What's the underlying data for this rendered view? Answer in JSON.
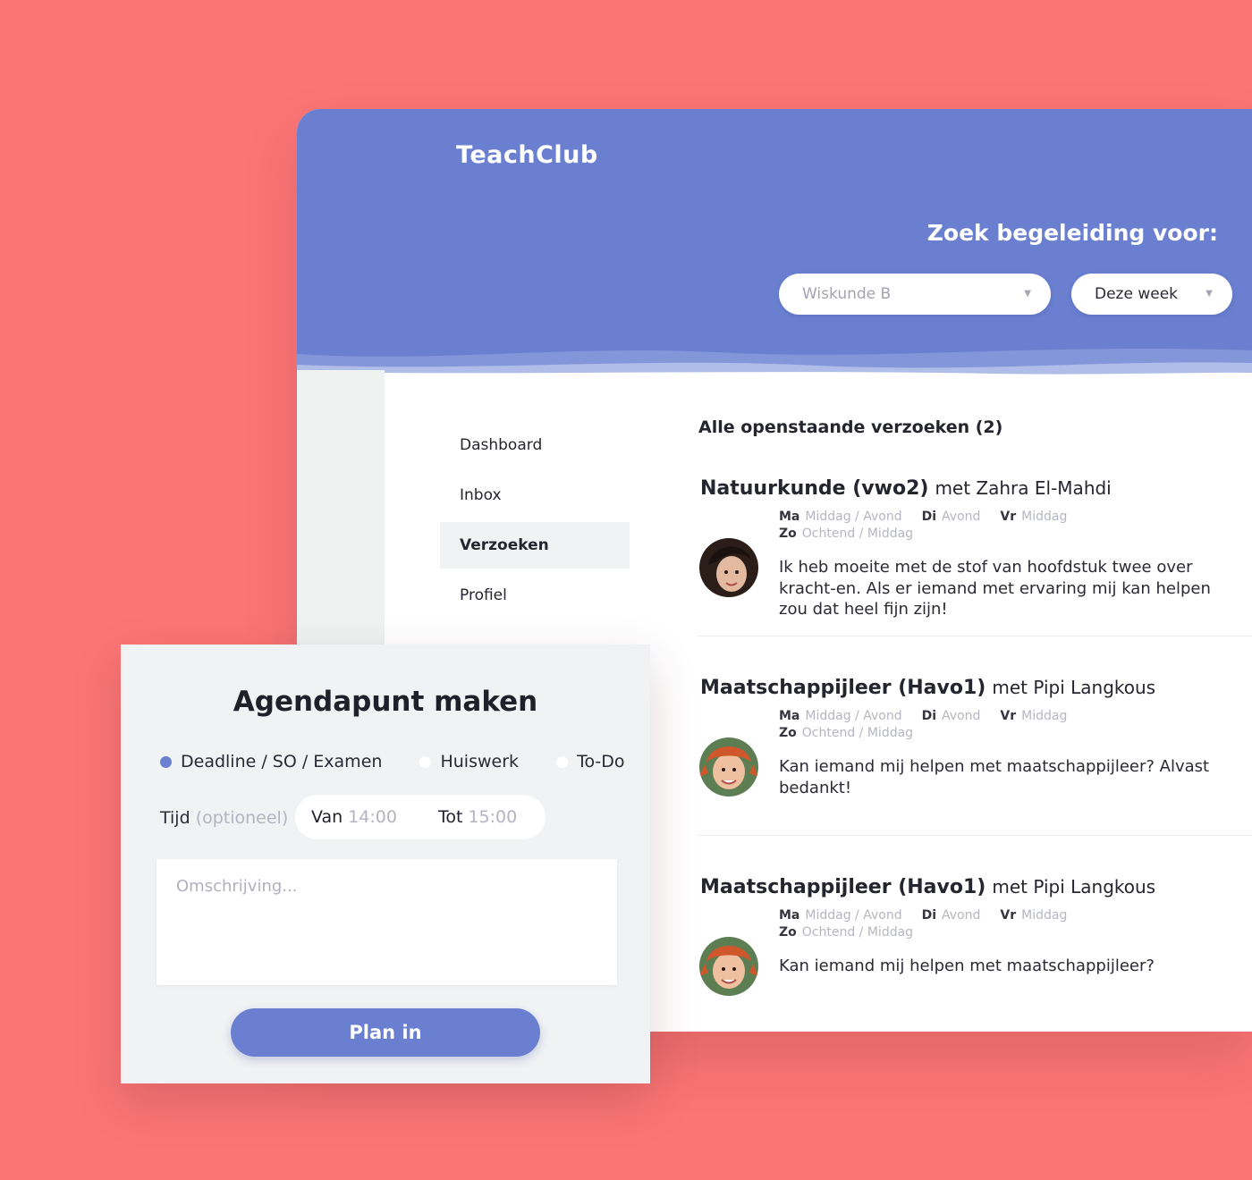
{
  "brand": {
    "name": "TeachClub"
  },
  "header": {
    "title": "Zoek begeleiding voor:",
    "subject_select": {
      "value": "Wiskunde B"
    },
    "period_select": {
      "value": "Deze week"
    }
  },
  "nav": {
    "items": [
      {
        "label": "Dashboard"
      },
      {
        "label": "Inbox"
      },
      {
        "label": "Verzoeken",
        "active": true
      },
      {
        "label": "Profiel"
      }
    ]
  },
  "requests": {
    "title": "Alle openstaande verzoeken (2)",
    "items": [
      {
        "subject": "Natuurkunde (vwo2)",
        "with": "met Zahra El-Mahdi",
        "times": [
          {
            "day": "Ma",
            "slot": "Middag / Avond"
          },
          {
            "day": "Di",
            "slot": "Avond"
          },
          {
            "day": "Vr",
            "slot": "Middag"
          },
          {
            "day": "Zo",
            "slot": "Ochtend / Middag"
          }
        ],
        "message": "Ik heb moeite met de stof van hoofdstuk twee over kracht-en. Als er iemand met ervaring mij kan helpen zou dat heel fijn zijn!"
      },
      {
        "subject": "Maatschappijleer (Havo1)",
        "with": "met Pipi Langkous",
        "times": [
          {
            "day": "Ma",
            "slot": "Middag / Avond"
          },
          {
            "day": "Di",
            "slot": "Avond"
          },
          {
            "day": "Vr",
            "slot": "Middag"
          },
          {
            "day": "Zo",
            "slot": "Ochtend / Middag"
          }
        ],
        "message": "Kan iemand mij helpen met maatschappijleer? Alvast bedankt!"
      },
      {
        "subject": "Maatschappijleer (Havo1)",
        "with": "met Pipi Langkous",
        "times": [
          {
            "day": "Ma",
            "slot": "Middag / Avond"
          },
          {
            "day": "Di",
            "slot": "Avond"
          },
          {
            "day": "Vr",
            "slot": "Middag"
          },
          {
            "day": "Zo",
            "slot": "Ochtend / Middag"
          }
        ],
        "message": "Kan iemand mij helpen met maatschappijleer?"
      }
    ]
  },
  "modal": {
    "title": "Agendapunt maken",
    "types": [
      {
        "label": "Deadline / SO / Examen",
        "selected": true
      },
      {
        "label": "Huiswerk",
        "selected": false
      },
      {
        "label": "To-Do",
        "selected": false
      }
    ],
    "time_label": "Tijd",
    "time_optional": "(optioneel)",
    "from_label": "Van",
    "from_placeholder": "14:00",
    "to_label": "Tot",
    "to_placeholder": "15:00",
    "description_placeholder": "Omschrijving...",
    "submit_label": "Plan in"
  },
  "colors": {
    "background": "#fa7576",
    "accent": "#6a7fd0"
  }
}
